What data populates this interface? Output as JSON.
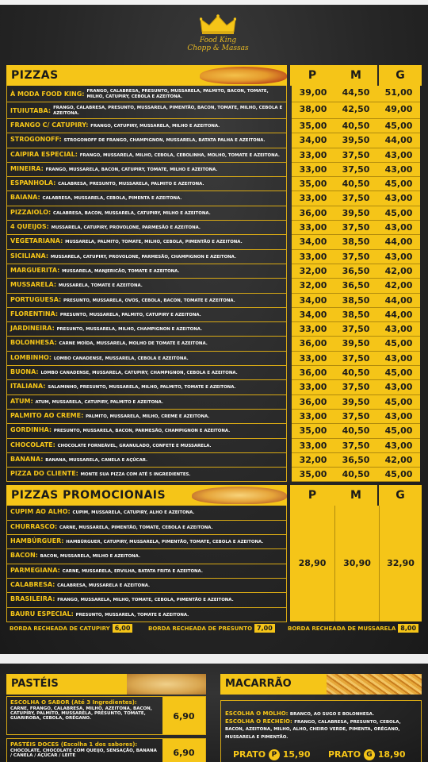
{
  "brand": {
    "line1": "Food King",
    "line2": "Chopp & Massas"
  },
  "pizzas": {
    "title": "PIZZAS",
    "sizes": [
      "P",
      "M",
      "G"
    ],
    "items": [
      {
        "name": "À MODA FOOD KING:",
        "ing": "FRANGO, CALABRESA, PRESUNTO, MUSSARELA, PALMITO, BACON, TOMATE, MILHO, CATUPIRY, CEBOLA E AZEITONA.",
        "p": "39,00",
        "m": "44,50",
        "g": "51,00"
      },
      {
        "name": "ITUIUTABA:",
        "ing": "FRANGO, CALABRESA, PRESUNTO, MUSSARELA, PIMENTÃO, BACON, TOMATE, MILHO, CEBOLA E AZEITONA.",
        "p": "38,00",
        "m": "42,50",
        "g": "49,00"
      },
      {
        "name": "FRANGO C/ CATUPIRY:",
        "ing": "FRANGO, CATUPIRY, MUSSARELA, MILHO E AZEITONA.",
        "p": "35,00",
        "m": "40,50",
        "g": "45,00"
      },
      {
        "name": "STROGONOFF:",
        "ing": "STROGONOFF DE FRANGO, CHAMPIGNON, MUSSARELA, BATATA PALHA E AZEITONA.",
        "p": "34,00",
        "m": "39,50",
        "g": "44,00"
      },
      {
        "name": "CAIPIRA ESPECIAL:",
        "ing": "FRANGO, MUSSARELA, MILHO, CEBOLA, CEBOLINHA, MOLHO, TOMATE E AZEITONA.",
        "p": "33,00",
        "m": "37,50",
        "g": "43,00"
      },
      {
        "name": "MINEIRA:",
        "ing": "FRANGO, MUSSARELA, BACON, CATUPIRY, TOMATE, MILHO E AZEITONA.",
        "p": "33,00",
        "m": "37,50",
        "g": "43,00"
      },
      {
        "name": "ESPANHOLA:",
        "ing": "CALABRESA, PRESUNTO, MUSSARELA, PALMITO E AZEITONA.",
        "p": "35,00",
        "m": "40,50",
        "g": "45,00"
      },
      {
        "name": "BAIANA:",
        "ing": "CALABRESA, MUSSARELA, CEBOLA, PIMENTA E AZEITONA.",
        "p": "33,00",
        "m": "37,50",
        "g": "43,00"
      },
      {
        "name": "PIZZAIOLO:",
        "ing": "CALABRESA, BACON, MUSSARELA, CATUPIRY, MILHO E AZEITONA.",
        "p": "36,00",
        "m": "39,50",
        "g": "45,00"
      },
      {
        "name": "4 QUEIJOS:",
        "ing": "MUSSARELA, CATUPIRY, PROVOLONE, PARMESÃO E AZEITONA.",
        "p": "33,00",
        "m": "37,50",
        "g": "43,00"
      },
      {
        "name": "VEGETARIANA:",
        "ing": "MUSSARELA, PALMITO, TOMATE, MILHO, CEBOLA, PIMENTÃO E AZEITONA.",
        "p": "34,00",
        "m": "38,50",
        "g": "44,00"
      },
      {
        "name": "SICILIANA:",
        "ing": "MUSSARELA, CATUPIRY, PROVOLONE, PARMESÃO, CHAMPIGNON E AZEITONA.",
        "p": "33,00",
        "m": "37,50",
        "g": "43,00"
      },
      {
        "name": "MARGUERITA:",
        "ing": "MUSSARELA, MANJERICÃO, TOMATE E AZEITONA.",
        "p": "32,00",
        "m": "36,50",
        "g": "42,00"
      },
      {
        "name": "MUSSARELA:",
        "ing": "MUSSARELA, TOMATE E AZEITONA.",
        "p": "32,00",
        "m": "36,50",
        "g": "42,00"
      },
      {
        "name": "PORTUGUESA:",
        "ing": "PRESUNTO, MUSSARELA, OVOS, CEBOLA, BACON, TOMATE E AZEITONA.",
        "p": "34,00",
        "m": "38,50",
        "g": "44,00"
      },
      {
        "name": "FLORENTINA:",
        "ing": "PRESUNTO, MUSSARELA, PALMITO, CATUPIRY E AZEITONA.",
        "p": "34,00",
        "m": "38,50",
        "g": "44,00"
      },
      {
        "name": "JARDINEIRA:",
        "ing": "PRESUNTO, MUSSARELA, MILHO, CHAMPIGNON E AZEITONA.",
        "p": "33,00",
        "m": "37,50",
        "g": "43,00"
      },
      {
        "name": "BOLONHESA:",
        "ing": "CARNE MOÍDA, MUSSARELA, MOLHO DE TOMATE E AZEITONA.",
        "p": "36,00",
        "m": "39,50",
        "g": "45,00"
      },
      {
        "name": "LOMBINHO:",
        "ing": "LOMBO CANADENSE, MUSSARELA, CEBOLA E AZEITONA.",
        "p": "33,00",
        "m": "37,50",
        "g": "43,00"
      },
      {
        "name": "BUONA:",
        "ing": "LOMBO CANADENSE, MUSSARELA, CATUPIRY, CHAMPIGNON, CEBOLA E AZEITONA.",
        "p": "36,00",
        "m": "40,50",
        "g": "45,00"
      },
      {
        "name": "ITALIANA:",
        "ing": "SALAMINHO, PRESUNTO, MUSSARELA, MILHO, PALMITO, TOMATE E AZEITONA.",
        "p": "33,00",
        "m": "37,50",
        "g": "43,00"
      },
      {
        "name": "ATUM:",
        "ing": "ATUM, MUSSARELA, CATUPIRY, PALMITO E AZEITONA.",
        "p": "36,00",
        "m": "39,50",
        "g": "45,00"
      },
      {
        "name": "PALMITO AO CREME:",
        "ing": "PALMITO, MUSSARELA, MILHO, CREME E AZEITONA.",
        "p": "33,00",
        "m": "37,50",
        "g": "43,00"
      },
      {
        "name": "GORDINHA:",
        "ing": "PRESUNTO, MUSSARELA, BACON, PARMESÃO, CHAMPIGNON E AZEITONA.",
        "p": "35,00",
        "m": "40,50",
        "g": "45,00"
      },
      {
        "name": "CHOCOLATE:",
        "ing": "CHOCOLATE FORNEÁVEL, GRANULADO, CONFETE E MUSSARELA.",
        "p": "33,00",
        "m": "37,50",
        "g": "43,00"
      },
      {
        "name": "BANANA:",
        "ing": "BANANA, MUSSARELA, CANELA E AÇÚCAR.",
        "p": "32,00",
        "m": "36,50",
        "g": "42,00"
      },
      {
        "name": "PIZZA DO CLIENTE:",
        "ing": "MONTE SUA PIZZA COM ATÉ 5 INGREDIENTES.",
        "p": "35,00",
        "m": "40,50",
        "g": "45,00"
      }
    ]
  },
  "promo": {
    "title": "PIZZAS PROMOCIONAIS",
    "sizes": [
      "P",
      "M",
      "G"
    ],
    "price_p": "28,90",
    "price_m": "30,90",
    "price_g": "32,90",
    "items": [
      {
        "name": "CUPIM AO ALHO:",
        "ing": "CUPIM, MUSSARELA, CATUPIRY, ALHO E AZEITONA."
      },
      {
        "name": "CHURRASCO:",
        "ing": "CARNE, MUSSARELA, PIMENTÃO, TOMATE, CEBOLA E AZEITONA."
      },
      {
        "name": "HAMBÚRGUER:",
        "ing": "HAMBÚRGUER, CATUPIRY, MUSSARELA, PIMENTÃO, TOMATE, CEBOLA E AZEITONA."
      },
      {
        "name": "BACON:",
        "ing": "BACON, MUSSARELA, MILHO E AZEITONA."
      },
      {
        "name": "PARMEGIANA:",
        "ing": "CARNE, MUSSARELA, ERVILHA, BATATA FRITA E AZEITONA."
      },
      {
        "name": "CALABRESA:",
        "ing": "CALABRESA, MUSSARELA E AZEITONA."
      },
      {
        "name": "BRASILEIRA:",
        "ing": "FRANGO, MUSSARELA, MILHO, TOMATE, CEBOLA, PIMENTÃO E AZEITONA."
      },
      {
        "name": "BAURU ESPECIAL:",
        "ing": "PRESUNTO, MUSSARELA, TOMATE E AZEITONA."
      }
    ]
  },
  "borda": [
    {
      "label": "BORDA RECHEADA DE CATUPIRY",
      "price": "6,00"
    },
    {
      "label": "BORDA RECHEADA DE PRESUNTO",
      "price": "7,00"
    },
    {
      "label": "BORDA RECHEADA DE MUSSARELA",
      "price": "8,00"
    }
  ],
  "pasteis": {
    "title": "PASTÉIS",
    "items": [
      {
        "head": "ESCOLHA O SABOR (Até 3 Ingredientes):",
        "desc": "CARNE, FRANGO, CALABRESA, MILHO, AZEITONA, BACON, CATUPIRY, PALMITO, MUSSARELA, PRESUNTO, TOMATE, GUARIROBA, CEBOLA, ORÉGANO.",
        "price": "6,90"
      },
      {
        "head": "PASTÉIS DOCES (Escolha 1 dos sabores):",
        "desc": "CHOCOLATE, CHOCOLATE COM QUEIJO, SENSAÇÃO, BANANA / CANELA / AÇÚCAR / LEITE",
        "price": "6,90"
      }
    ]
  },
  "macarrao": {
    "title": "MACARRÃO",
    "molho_label": "ESCOLHA O MOLHO:",
    "molho": "BRANCO, AO SUGO E BOLONHESA.",
    "recheio_label": "ESCOLHA O RECHEIO:",
    "recheio": "FRANGO, CALABRESA, PRESUNTO, CEBOLA, BACON, AZEITONA, MILHO, ALHO, CHEIRO VERDE, PIMENTA, ORÉGANO, MUSSARELA E PIMENTÃO.",
    "prato_label": "PRATO",
    "p_letter": "P",
    "p_price": "15,90",
    "g_letter": "G",
    "g_price": "18,90"
  },
  "colors": {
    "accent": "#f5c518",
    "background": "#202020",
    "ingredients": "#ffffff"
  }
}
